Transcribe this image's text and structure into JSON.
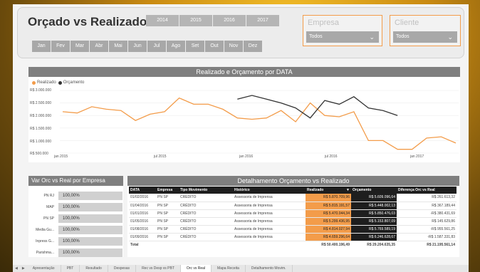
{
  "header": {
    "title": "Orçado vs Realizado",
    "years": [
      "2014",
      "2015",
      "2016",
      "2017"
    ],
    "months": [
      "Jan",
      "Fev",
      "Mar",
      "Abr",
      "Mai",
      "Jun",
      "Jul",
      "Ago",
      "Set",
      "Out",
      "Nov",
      "Dez"
    ],
    "empresa": {
      "label": "Empresa",
      "value": "Todos"
    },
    "cliente": {
      "label": "Cliente",
      "value": "Todos"
    }
  },
  "line_chart": {
    "title": "Realizado e Orçamento por DATA",
    "legend": [
      "Realizado",
      "Orçamento"
    ],
    "colors": {
      "realizado": "#f39c4a",
      "orcamento": "#333333"
    },
    "y_ticks": [
      "R$ 3.000.000",
      "R$ 2.500.000",
      "R$ 2.000.000",
      "R$ 1.500.000",
      "R$ 1.000.000",
      "R$ 500.000"
    ],
    "x_ticks": [
      "jan 2015",
      "jul 2015",
      "jan 2016",
      "jul 2016",
      "jan 2017"
    ]
  },
  "chart_data": {
    "type": "line",
    "title": "Realizado e Orçamento por DATA",
    "ylim": [
      500000,
      3000000
    ],
    "x": [
      "2015-01",
      "2015-02",
      "2015-03",
      "2015-04",
      "2015-05",
      "2015-06",
      "2015-07",
      "2015-08",
      "2015-09",
      "2015-10",
      "2015-11",
      "2015-12",
      "2016-01",
      "2016-02",
      "2016-03",
      "2016-04",
      "2016-05",
      "2016-06",
      "2016-07",
      "2016-08",
      "2016-09",
      "2016-10",
      "2016-11",
      "2016-12",
      "2017-01",
      "2017-02",
      "2017-03",
      "2017-04"
    ],
    "series": [
      {
        "name": "Realizado",
        "values": [
          2150000,
          2100000,
          2350000,
          2250000,
          2200000,
          1800000,
          2050000,
          2150000,
          2700000,
          2450000,
          2450000,
          2250000,
          1900000,
          1850000,
          1900000,
          2200000,
          1750000,
          2500000,
          2000000,
          1950000,
          2150000,
          1000000,
          1000000,
          650000,
          650000,
          1100000,
          1150000,
          900000
        ]
      },
      {
        "name": "Orçamento",
        "values": [
          null,
          null,
          null,
          null,
          null,
          null,
          null,
          null,
          null,
          null,
          null,
          null,
          2650000,
          2800000,
          2650000,
          2500000,
          2300000,
          1900000,
          2600000,
          2450000,
          2750000,
          2300000,
          2200000,
          2000000,
          null,
          null,
          null,
          null
        ]
      }
    ]
  },
  "var_chart": {
    "title": "Var Orc vs Real por Empresa",
    "rows": [
      {
        "name": "PN RJ",
        "value": "100,00%"
      },
      {
        "name": "MAP",
        "value": "100,00%"
      },
      {
        "name": "PN SP",
        "value": "100,00%"
      },
      {
        "name": "Media Gu...",
        "value": "100,00%"
      },
      {
        "name": "Inpress G...",
        "value": "100,00%"
      },
      {
        "name": "Parishma...",
        "value": "100,00%"
      }
    ]
  },
  "table": {
    "title": "Detalhamento Orçamento vs Realizado",
    "columns": [
      "DATA",
      "Empresa",
      "Tipo Movimento",
      "Histórico",
      "Realizado",
      "Orçamento",
      "Diferença Orc vs Real"
    ],
    "rows": [
      [
        "01/02/2016",
        "PN SP",
        "CRÉDITO",
        "Assessoria de Imprensa",
        "R$ 5.870.709,96",
        "R$ 5.609.096,64",
        "R$ 261.613,32"
      ],
      [
        "01/04/2016",
        "PN SP",
        "CRÉDITO",
        "Assessoria de Imprensa",
        "R$ 5.815.191,57",
        "R$ 5.448.002,13",
        "R$ 367.189,44"
      ],
      [
        "01/01/2016",
        "PN SP",
        "CRÉDITO",
        "Assessoria de Imprensa",
        "R$ 5.470.044,34",
        "R$ 5.850.476,03",
        "-R$ 380.431,69"
      ],
      [
        "01/05/2016",
        "PN SP",
        "CRÉDITO",
        "Assessoria de Imprensa",
        "R$ 5.299.436,95",
        "R$ 5.153.807,09",
        "R$ 145.629,86"
      ],
      [
        "01/08/2016",
        "PN SP",
        "CRÉDITO",
        "Assessoria de Imprensa",
        "R$ 4.814.027,94",
        "R$ 5.769.589,19",
        "-R$ 955.561,25"
      ],
      [
        "01/09/2016",
        "PN SP",
        "CRÉDITO",
        "Assessoria de Imprensa",
        "R$ 4.659.296,64",
        "R$ 6.246.628,67",
        "-R$ 1.587.331,83"
      ]
    ],
    "total_label": "Total",
    "totals": [
      "R$ 50.400.196,49",
      "R$ 29.204.635,35",
      "R$ 21.195.561,14"
    ]
  },
  "tabs": [
    "Apresentação",
    "PBT",
    "Resultado",
    "Despesas",
    "Rec vs Desp vs PBT",
    "Orc vs Real",
    "Mapa Receita",
    "Detalhamento Movim."
  ],
  "active_tab": "Orc vs Real"
}
